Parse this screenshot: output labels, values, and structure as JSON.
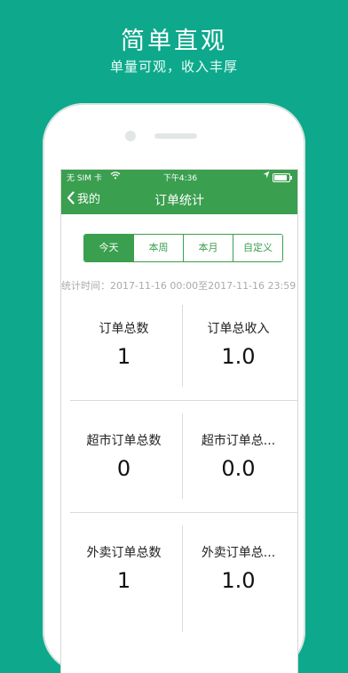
{
  "hero": {
    "title": "简单直观",
    "subtitle": "单量可观，收入丰厚"
  },
  "status": {
    "carrier": "无 SIM 卡",
    "time": "下午4:36",
    "battery_level": 0.85
  },
  "nav": {
    "back_label": "我的",
    "title": "订单统计"
  },
  "tabs": [
    {
      "label": "今天",
      "active": true
    },
    {
      "label": "本周",
      "active": false
    },
    {
      "label": "本月",
      "active": false
    },
    {
      "label": "自定义",
      "active": false
    }
  ],
  "range_text": "统计时间：2017-11-16 00:00至2017-11-16 23:59",
  "stats": [
    {
      "label": "订单总数",
      "value": "1"
    },
    {
      "label": "订单总收入",
      "value": "1.0"
    },
    {
      "label": "超市订单总数",
      "value": "0"
    },
    {
      "label": "超市订单总...",
      "value": "0.0"
    },
    {
      "label": "外卖订单总数",
      "value": "1"
    },
    {
      "label": "外卖订单总...",
      "value": "1.0"
    }
  ]
}
